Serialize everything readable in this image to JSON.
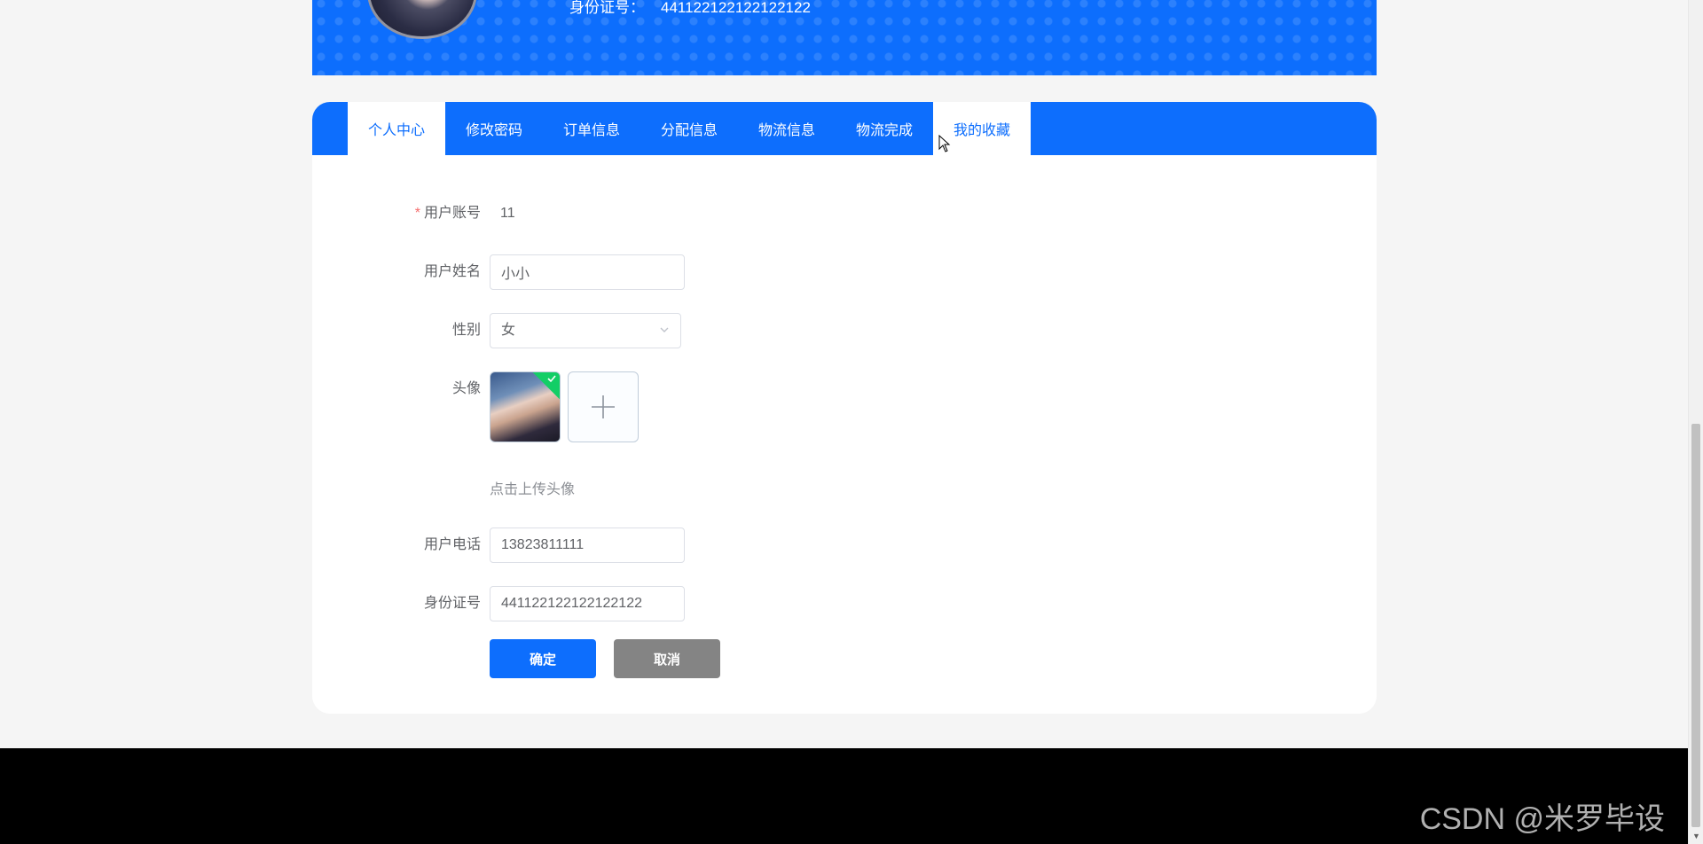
{
  "banner": {
    "id_label": "身份证号：",
    "id_value": "441122122122122122"
  },
  "tabs": [
    {
      "label": "个人中心",
      "active": true
    },
    {
      "label": "修改密码",
      "active": false
    },
    {
      "label": "订单信息",
      "active": false
    },
    {
      "label": "分配信息",
      "active": false
    },
    {
      "label": "物流信息",
      "active": false
    },
    {
      "label": "物流完成",
      "active": false
    },
    {
      "label": "我的收藏",
      "active": true
    }
  ],
  "form": {
    "required_mark": "*",
    "account_label": "用户账号",
    "account_value": "11",
    "name_label": "用户姓名",
    "name_value": "小小",
    "gender_label": "性别",
    "gender_value": "女",
    "avatar_label": "头像",
    "upload_hint": "点击上传头像",
    "phone_label": "用户电话",
    "phone_value": "13823811111",
    "idcard_label": "身份证号",
    "idcard_value": "441122122122122122"
  },
  "buttons": {
    "confirm": "确定",
    "cancel": "取消"
  },
  "watermark": "CSDN @米罗毕设",
  "colors": {
    "primary": "#0d6efd",
    "cancel": "#848484",
    "success": "#13ce66",
    "required": "#f56c6c"
  }
}
